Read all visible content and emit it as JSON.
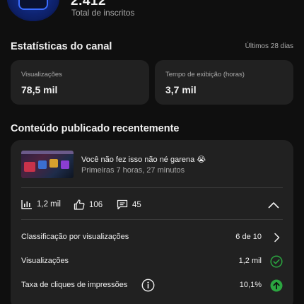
{
  "header": {
    "subscriber_count": "2.412",
    "subscriber_label": "Total de inscritos"
  },
  "channel_stats": {
    "title": "Estatísticas do canal",
    "period": "Últimos 28 dias",
    "cards": [
      {
        "label": "Visualizações",
        "value": "78,5 mil"
      },
      {
        "label": "Tempo de exibição (horas)",
        "value": "3,7 mil"
      }
    ]
  },
  "recent_content": {
    "title": "Conteúdo publicado recentemente",
    "video": {
      "title": "Você não fez isso não né garena 😭",
      "meta": "Primeiras 7 horas, 27 minutos"
    },
    "metrics": {
      "views": "1,2 mil",
      "likes": "106",
      "comments": "45"
    },
    "rows": [
      {
        "label": "Classificação por visualizações",
        "value": "6 de 10"
      },
      {
        "label": "Visualizações",
        "value": "1,2 mil"
      },
      {
        "label": "Taxa de cliques de impressões",
        "value": "10,1%"
      }
    ]
  },
  "colors": {
    "background": "#0f0f0f",
    "card": "#212121",
    "secondary_text": "#aaaaaa",
    "success": "#2ba640"
  }
}
